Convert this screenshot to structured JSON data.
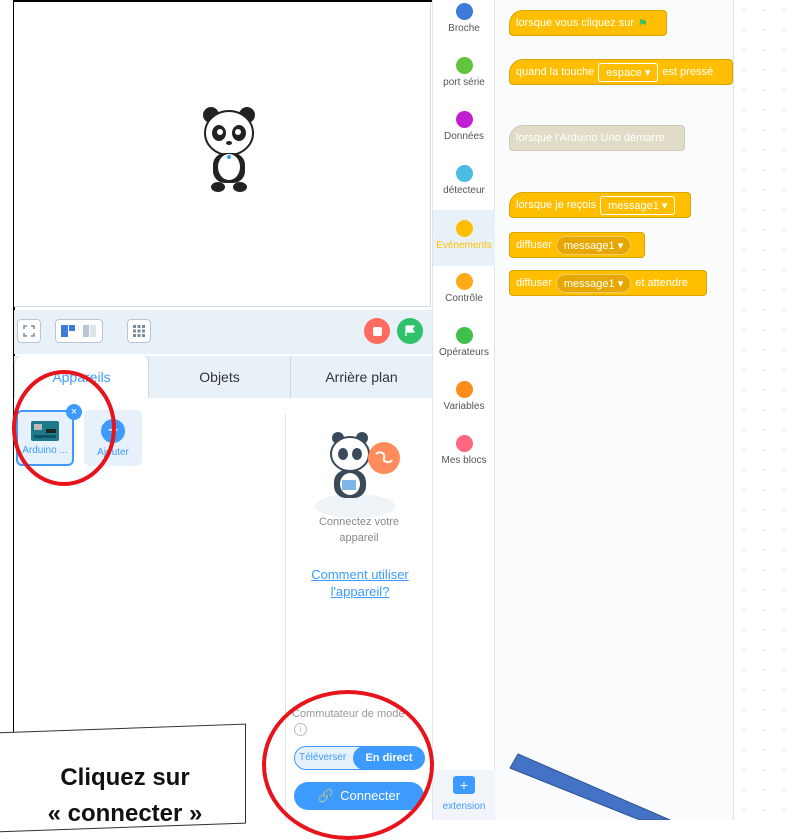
{
  "stage_toolbar": {
    "icons": [
      "fullscreen-icon",
      "layout-stage-icon",
      "layout-small-icon",
      "grid-icon",
      "stop-icon",
      "green-flag-icon"
    ]
  },
  "tabs": [
    {
      "label": "Appareils",
      "active": true
    },
    {
      "label": "Objets",
      "active": false
    },
    {
      "label": "Arrière plan",
      "active": false
    }
  ],
  "devices": {
    "arduino_label": "Arduino ...",
    "add_label": "Ajouter"
  },
  "connect_panel": {
    "message": "Connectez votre appareil",
    "help_link": "Comment utiliser l'appareil?",
    "mode_switch_label": "Commutateur de mode",
    "mode_options": [
      "Téléverser",
      "En direct"
    ],
    "mode_selected": "En direct",
    "connect_button": "Connecter"
  },
  "categories": [
    {
      "label": "Broche",
      "color": "#3d7bd9"
    },
    {
      "label": "port série",
      "color": "#60c43c"
    },
    {
      "label": "Données",
      "color": "#c020d0"
    },
    {
      "label": "détecteur",
      "color": "#4dbce3"
    },
    {
      "label": "Événements",
      "color": "#ffbf00",
      "active": true
    },
    {
      "label": "Contrôle",
      "color": "#ffab19"
    },
    {
      "label": "Opérateurs",
      "color": "#40bf4a"
    },
    {
      "label": "Variables",
      "color": "#ff8c1a"
    },
    {
      "label": "Mes blocs",
      "color": "#ff6680"
    }
  ],
  "extension_label": "extension",
  "blocks": {
    "b1": "lorsque vous cliquez sur",
    "b2_pre": "quand la touche",
    "b2_key": "espace",
    "b2_post": "est pressé",
    "b3": "lorsque l'Arduino Uno démarre",
    "b4_pre": "lorsque je reçois",
    "b4_msg": "message1",
    "b5_pre": "diffuser",
    "b5_msg": "message1",
    "b6_pre": "diffuser",
    "b6_msg": "message1",
    "b6_post": "et attendre"
  },
  "annotation": {
    "callout_line1": "Cliquez sur",
    "callout_line2": "« connecter »",
    "accent": "#e8141c",
    "arrow_color": "#4472c4"
  }
}
